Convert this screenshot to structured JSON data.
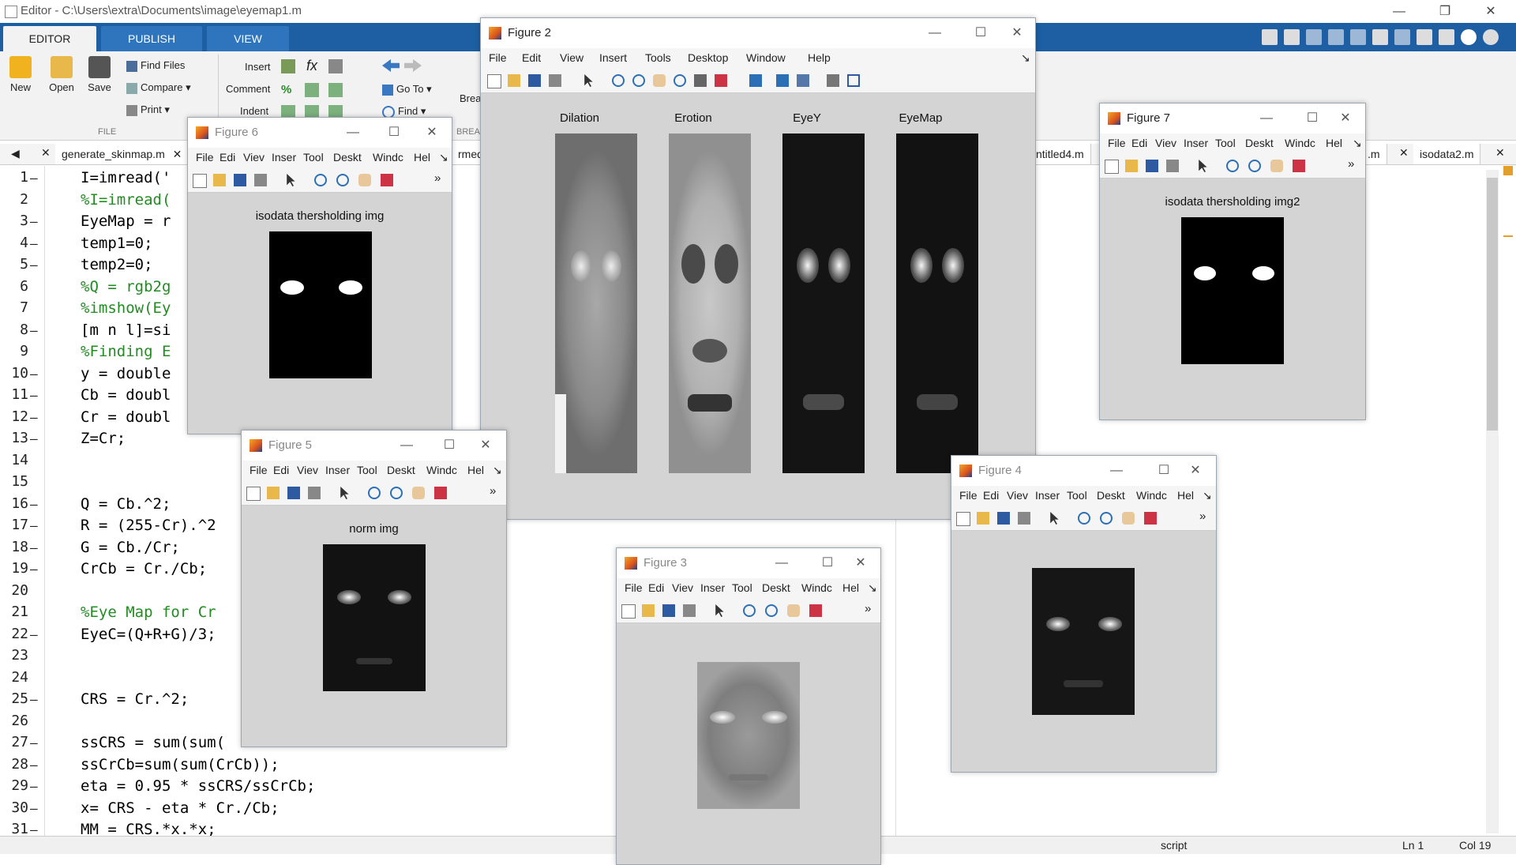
{
  "window": {
    "title": "Editor - C:\\Users\\extra\\Documents\\image\\eyemap1.m",
    "min": "—",
    "restore": "❐",
    "close": "✕"
  },
  "ribbon": {
    "tabs": [
      {
        "label": "EDITOR"
      },
      {
        "label": "PUBLISH"
      },
      {
        "label": "VIEW"
      }
    ],
    "file_buttons": [
      {
        "label": "New"
      },
      {
        "label": "Open"
      },
      {
        "label": "Save"
      }
    ],
    "find_files": "Find Files",
    "compare": "Compare",
    "print": "Print",
    "file_section": "FILE",
    "insert": "Insert",
    "comment": "Comment",
    "indent": "Indent",
    "goto": "Go To",
    "find": "Find",
    "break": "Brea",
    "break_section": "BREA"
  },
  "file_tabs": [
    {
      "label": "generate_skinmap.m"
    },
    {
      "label": "rmed"
    },
    {
      "label": "ntitled4.m"
    },
    {
      "label": ".m"
    },
    {
      "label": "isodata2.m"
    }
  ],
  "code_lines": [
    {
      "n": "1",
      "d": "–",
      "t": "I=imread('",
      "c": false
    },
    {
      "n": "2",
      "d": "",
      "t": "%I=imread(",
      "c": true
    },
    {
      "n": "3",
      "d": "–",
      "t": "EyeMap = r",
      "c": false
    },
    {
      "n": "4",
      "d": "–",
      "t": "temp1=0;",
      "c": false
    },
    {
      "n": "5",
      "d": "–",
      "t": "temp2=0;",
      "c": false
    },
    {
      "n": "6",
      "d": "",
      "t": "%Q = rgb2g",
      "c": true
    },
    {
      "n": "7",
      "d": "",
      "t": "%imshow(Ey",
      "c": true
    },
    {
      "n": "8",
      "d": "–",
      "t": "[m n l]=si",
      "c": false
    },
    {
      "n": "9",
      "d": "",
      "t": "%Finding E",
      "c": true
    },
    {
      "n": "10",
      "d": "–",
      "t": "y = double",
      "c": false
    },
    {
      "n": "11",
      "d": "–",
      "t": "Cb = doubl",
      "c": false
    },
    {
      "n": "12",
      "d": "–",
      "t": "Cr = doubl",
      "c": false
    },
    {
      "n": "13",
      "d": "–",
      "t": "Z=Cr;",
      "c": false
    },
    {
      "n": "14",
      "d": "",
      "t": "",
      "c": false
    },
    {
      "n": "15",
      "d": "",
      "t": "",
      "c": false
    },
    {
      "n": "16",
      "d": "–",
      "t": "Q = Cb.^2;",
      "c": false
    },
    {
      "n": "17",
      "d": "–",
      "t": "R = (255-Cr).^2",
      "c": false
    },
    {
      "n": "18",
      "d": "–",
      "t": "G = Cb./Cr;",
      "c": false
    },
    {
      "n": "19",
      "d": "–",
      "t": "CrCb = Cr./Cb;",
      "c": false
    },
    {
      "n": "20",
      "d": "",
      "t": "",
      "c": false
    },
    {
      "n": "21",
      "d": "",
      "t": "%Eye Map for Cr",
      "c": true
    },
    {
      "n": "22",
      "d": "–",
      "t": "EyeC=(Q+R+G)/3;",
      "c": false
    },
    {
      "n": "23",
      "d": "",
      "t": "",
      "c": false
    },
    {
      "n": "24",
      "d": "",
      "t": "",
      "c": false
    },
    {
      "n": "25",
      "d": "–",
      "t": "CRS = Cr.^2;",
      "c": false
    },
    {
      "n": "26",
      "d": "",
      "t": "",
      "c": false
    },
    {
      "n": "27",
      "d": "–",
      "t": "ssCRS = sum(sum(",
      "c": false
    },
    {
      "n": "28",
      "d": "–",
      "t": "ssCrCb=sum(sum(CrCb));",
      "c": false
    },
    {
      "n": "29",
      "d": "–",
      "t": "eta = 0.95 * ssCRS/ssCrCb;",
      "c": false
    },
    {
      "n": "30",
      "d": "–",
      "t": "x= CRS - eta * Cr./Cb;",
      "c": false
    },
    {
      "n": "31",
      "d": "–",
      "t": "MM = CRS.*x.*x;",
      "c": false
    }
  ],
  "status": {
    "mode": "script",
    "ln": "Ln  1",
    "col": "Col  19"
  },
  "menus": {
    "full": [
      "File",
      "Edit",
      "View",
      "Insert",
      "Tools",
      "Desktop",
      "Window",
      "Help"
    ],
    "short": [
      "File",
      "Edi",
      "Viev",
      "Inser",
      "Tool",
      "Deskt",
      "Windc",
      "Hel"
    ]
  },
  "figures": {
    "fig2": {
      "title": "Figure 2",
      "panels": [
        "Dilation",
        "Erotion",
        "EyeY",
        "EyeMap"
      ]
    },
    "fig6": {
      "title": "Figure 6",
      "plot": "isodata thersholding img"
    },
    "fig7": {
      "title": "Figure 7",
      "plot": "isodata thersholding img2"
    },
    "fig5": {
      "title": "Figure 5",
      "plot": "norm img"
    },
    "fig4": {
      "title": "Figure 4",
      "plot": ""
    },
    "fig3": {
      "title": "Figure 3",
      "plot": ""
    }
  },
  "colors": {
    "ribbon_blue": "#1e5fa3",
    "comment_green": "#228b22",
    "figure_bg": "#d4d4d4"
  }
}
